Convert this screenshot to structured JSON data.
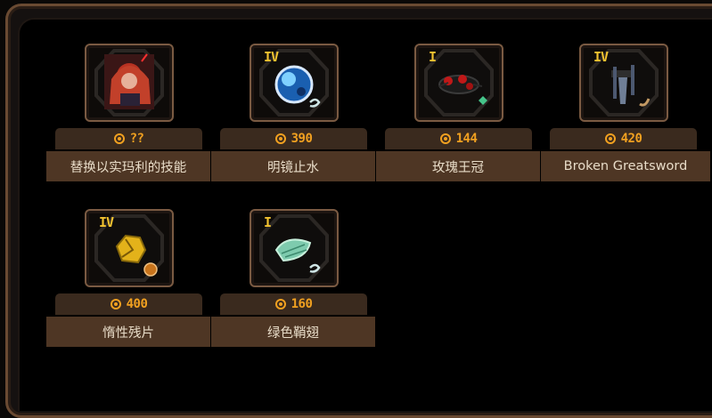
{
  "shop": {
    "items": [
      {
        "name": "替换以实玛利的技能",
        "price": "??",
        "tier": "",
        "icon": "ishmael-portrait-icon"
      },
      {
        "name": "明镜止水",
        "price": "390",
        "tier": "IV",
        "icon": "blue-orb-icon"
      },
      {
        "name": "玫瑰王冠",
        "price": "144",
        "tier": "I",
        "icon": "rose-crown-icon"
      },
      {
        "name": "Broken Greatsword",
        "price": "420",
        "tier": "IV",
        "icon": "broken-greatsword-icon"
      },
      {
        "name": "惰性残片",
        "price": "400",
        "tier": "IV",
        "icon": "gold-shard-icon"
      },
      {
        "name": "绿色鞘翅",
        "price": "160",
        "tier": "I",
        "icon": "green-elytra-icon"
      }
    ]
  },
  "colors": {
    "price": "#f0a020",
    "tier": "#f2c230",
    "name_bar": "#4e3624",
    "price_bar": "#3a2a1e",
    "frame": "#7a5a42"
  }
}
